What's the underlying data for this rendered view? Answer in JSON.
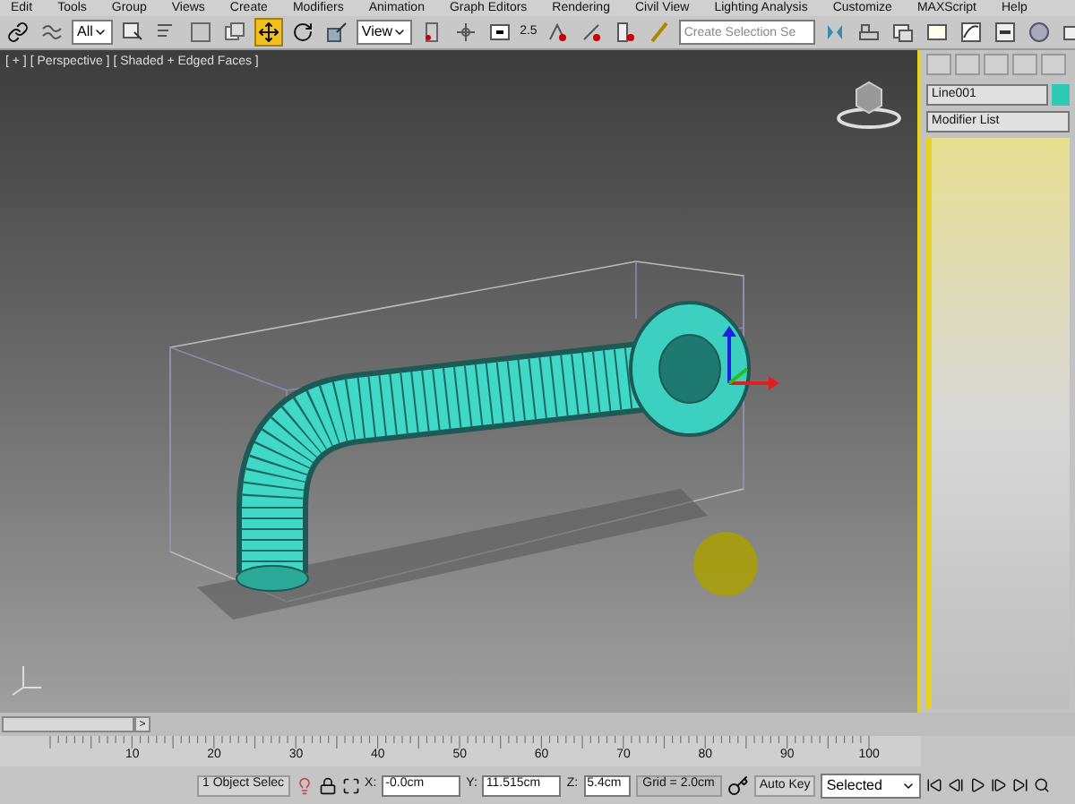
{
  "menu": [
    "Edit",
    "Tools",
    "Group",
    "Views",
    "Create",
    "Modifiers",
    "Animation",
    "Graph Editors",
    "Rendering",
    "Civil View",
    "Lighting Analysis",
    "Customize",
    "MAXScript",
    "Help"
  ],
  "toolbar": {
    "selection_filter": "All",
    "reference_coordinate_system": "View",
    "snap_value": "2.5",
    "named_selection_placeholder": "Create Selection Se"
  },
  "viewport": {
    "labels": [
      "[ + ]",
      "[ Perspective ]",
      "[ Shaded + Edged Faces ]"
    ]
  },
  "command_panel": {
    "object_name": "Line001",
    "modifier_list": "Modifier List"
  },
  "time_slider": {
    "next_button": ">"
  },
  "ruler": {
    "labels": [
      "10",
      "20",
      "30",
      "40",
      "50",
      "60",
      "70",
      "80",
      "90",
      "100"
    ]
  },
  "status_bar": {
    "selection": "1 Object Selec",
    "x_label": "X:",
    "x": "-0.0cm",
    "y_label": "Y:",
    "y": "11.515cm",
    "z_label": "Z:",
    "z": "5.4cm",
    "grid": "Grid = 2.0cm",
    "auto_key": "Auto Key",
    "key_filter": "Selected"
  }
}
